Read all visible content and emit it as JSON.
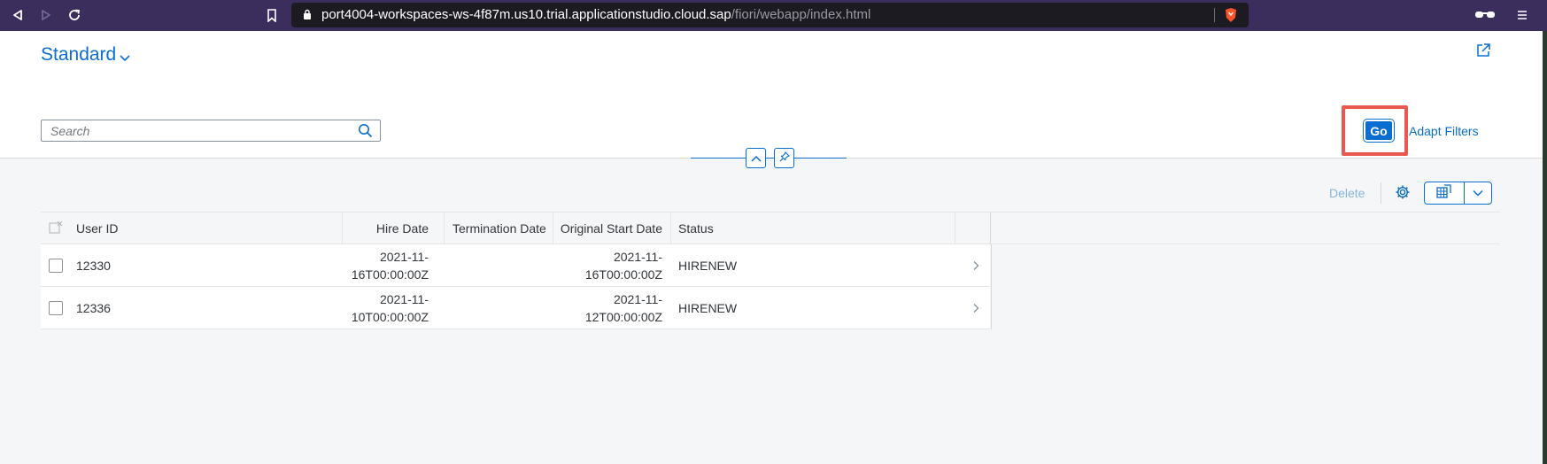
{
  "browser": {
    "url_main": "port4004-workspaces-ws-4f87m.us10.trial.applicationstudio.cloud.sap",
    "url_path": "/fiori/webapp/index.html"
  },
  "header": {
    "variant_title": "Standard",
    "search_placeholder": "Search",
    "go_label": "Go",
    "adapt_filters_label": "Adapt Filters"
  },
  "toolbar": {
    "delete_label": "Delete"
  },
  "table": {
    "columns": [
      "User ID",
      "Hire Date",
      "Termination Date",
      "Original Start Date",
      "Status"
    ],
    "rows": [
      {
        "user_id": "12330",
        "hire_date_1": "2021-11-",
        "hire_date_2": "16T00:00:00Z",
        "termination_date": "",
        "orig_start_1": "2021-11-",
        "orig_start_2": "16T00:00:00Z",
        "status": "HIRENEW"
      },
      {
        "user_id": "12336",
        "hire_date_1": "2021-11-",
        "hire_date_2": "10T00:00:00Z",
        "termination_date": "",
        "orig_start_1": "2021-11-",
        "orig_start_2": "12T00:00:00Z",
        "status": "HIRENEW"
      }
    ]
  },
  "colors": {
    "accent": "#0a6ed1",
    "highlight": "#e8584f",
    "browser_bar": "#3b2d5c"
  }
}
